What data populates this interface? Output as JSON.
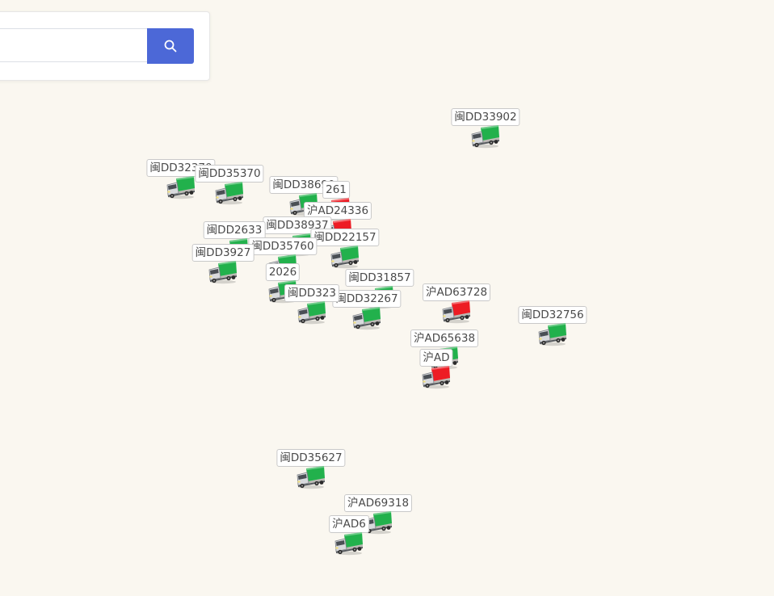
{
  "search": {
    "value": "",
    "placeholder": "",
    "button_icon": "search-icon",
    "button_color": "#4c68d7"
  },
  "map": {
    "background": "#faf7f0",
    "marker_icon": "truck-icon",
    "status_colors": {
      "green": "#22b14c",
      "red": "#ed1c24"
    }
  },
  "vehicles": [
    {
      "plate": "闽DD33902",
      "status": "green"
    },
    {
      "plate": "闽DD32370",
      "status": "green"
    },
    {
      "plate": "闽DD35370",
      "status": "green"
    },
    {
      "plate": "闽DD38690",
      "status": "green"
    },
    {
      "plate": "261",
      "status": "red"
    },
    {
      "plate": "沪AD24336",
      "status": "red"
    },
    {
      "plate": "闽DD38937",
      "status": "green"
    },
    {
      "plate": "闽DD2633",
      "status": "green"
    },
    {
      "plate": "闽DD22157",
      "status": "green"
    },
    {
      "plate": "闽DD35760",
      "status": "green"
    },
    {
      "plate": "闽DD3927",
      "status": "green"
    },
    {
      "plate": "2026",
      "status": "green"
    },
    {
      "plate": "闽DD31857",
      "status": "green"
    },
    {
      "plate": "闽DD32267",
      "status": "green"
    },
    {
      "plate": "闽DD323",
      "status": "green"
    },
    {
      "plate": "沪AD63728",
      "status": "red"
    },
    {
      "plate": "闽DD32756",
      "status": "green"
    },
    {
      "plate": "沪AD65638",
      "status": "green"
    },
    {
      "plate": "沪AD",
      "status": "red"
    },
    {
      "plate": "闽DD35627",
      "status": "green"
    },
    {
      "plate": "沪AD69318",
      "status": "green"
    },
    {
      "plate": "沪AD6",
      "status": "green"
    }
  ]
}
